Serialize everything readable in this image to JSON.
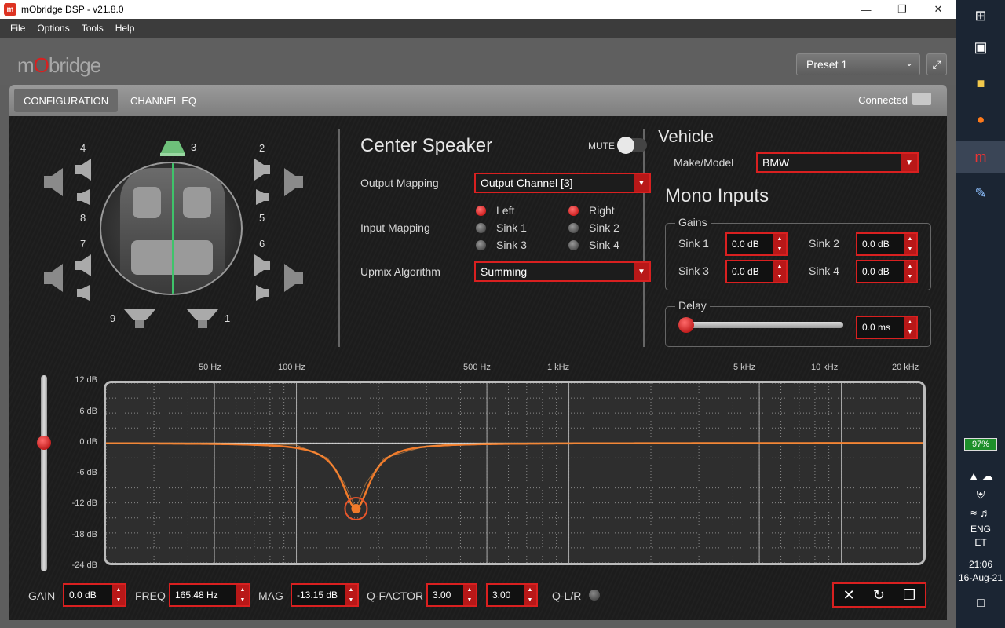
{
  "window": {
    "title": "mObridge DSP - v21.8.0"
  },
  "menu": [
    "File",
    "Options",
    "Tools",
    "Help"
  ],
  "header": {
    "logo": "mObridge",
    "preset": "Preset 1"
  },
  "tabs": [
    {
      "label": "CONFIGURATION",
      "active": true
    },
    {
      "label": "CHANNEL EQ",
      "active": false
    }
  ],
  "status": "Connected",
  "speakers": {
    "n4": "4",
    "n3": "3",
    "n2": "2",
    "n8": "8",
    "n5": "5",
    "n7": "7",
    "n6": "6",
    "n9": "9",
    "n1": "1"
  },
  "center": {
    "title": "Center Speaker",
    "mute_label": "MUTE",
    "output_mapping_label": "Output Mapping",
    "output_mapping_value": "Output Channel [3]",
    "input_mapping_label": "Input Mapping",
    "inputs": [
      {
        "label": "Left",
        "on": true
      },
      {
        "label": "Right",
        "on": true
      },
      {
        "label": "Sink 1",
        "on": false
      },
      {
        "label": "Sink 2",
        "on": false
      },
      {
        "label": "Sink 3",
        "on": false
      },
      {
        "label": "Sink 4",
        "on": false
      }
    ],
    "upmix_label": "Upmix Algorithm",
    "upmix_value": "Summing"
  },
  "vehicle": {
    "title": "Vehicle",
    "make_label": "Make/Model",
    "make_value": "BMW"
  },
  "mono": {
    "title": "Mono Inputs",
    "gains_label": "Gains",
    "gains": [
      {
        "label": "Sink 1",
        "value": "0.0 dB"
      },
      {
        "label": "Sink 2",
        "value": "0.0 dB"
      },
      {
        "label": "Sink 3",
        "value": "0.0 dB"
      },
      {
        "label": "Sink 4",
        "value": "0.0 dB"
      }
    ],
    "delay_label": "Delay",
    "delay_value": "0.0 ms"
  },
  "eq": {
    "freq_labels": [
      "50 Hz",
      "100 Hz",
      "500 Hz",
      "1 kHz",
      "5 kHz",
      "10 kHz",
      "20 kHz"
    ],
    "db_labels": [
      "12 dB",
      "6 dB",
      "0 dB",
      "-6 dB",
      "-12 dB",
      "-18 dB",
      "-24 dB"
    ],
    "gain_label": "GAIN",
    "gain_value": "0.0 dB",
    "freq_label": "FREQ",
    "freq_value": "165.48 Hz",
    "mag_label": "MAG",
    "mag_value": "-13.15 dB",
    "q_label": "Q-FACTOR",
    "q1_value": "3.00",
    "q2_value": "3.00",
    "qlr_label": "Q-L/R"
  },
  "tray": {
    "battery": "97%",
    "lang1": "ENG",
    "lang2": "ET",
    "time": "21:06",
    "date": "16-Aug-21"
  },
  "colors": {
    "accent": "#d92020",
    "curve": "#f07a2a",
    "background": "#1c1c1c"
  },
  "chart_data": {
    "type": "line",
    "x": [
      20,
      50,
      100,
      130,
      150,
      165.48,
      180,
      210,
      300,
      500,
      1000,
      5000,
      20000
    ],
    "series": [
      {
        "values": [
          0,
          0,
          -0.4,
          -3,
          -8,
          -13.15,
          -8,
          -3,
          -0.6,
          0,
          0,
          0,
          0
        ]
      }
    ],
    "xlabel": "",
    "ylabel": "",
    "xscale": "log",
    "ylim": [
      -24,
      12
    ],
    "xlim": [
      20,
      20000
    ],
    "grid": true
  }
}
